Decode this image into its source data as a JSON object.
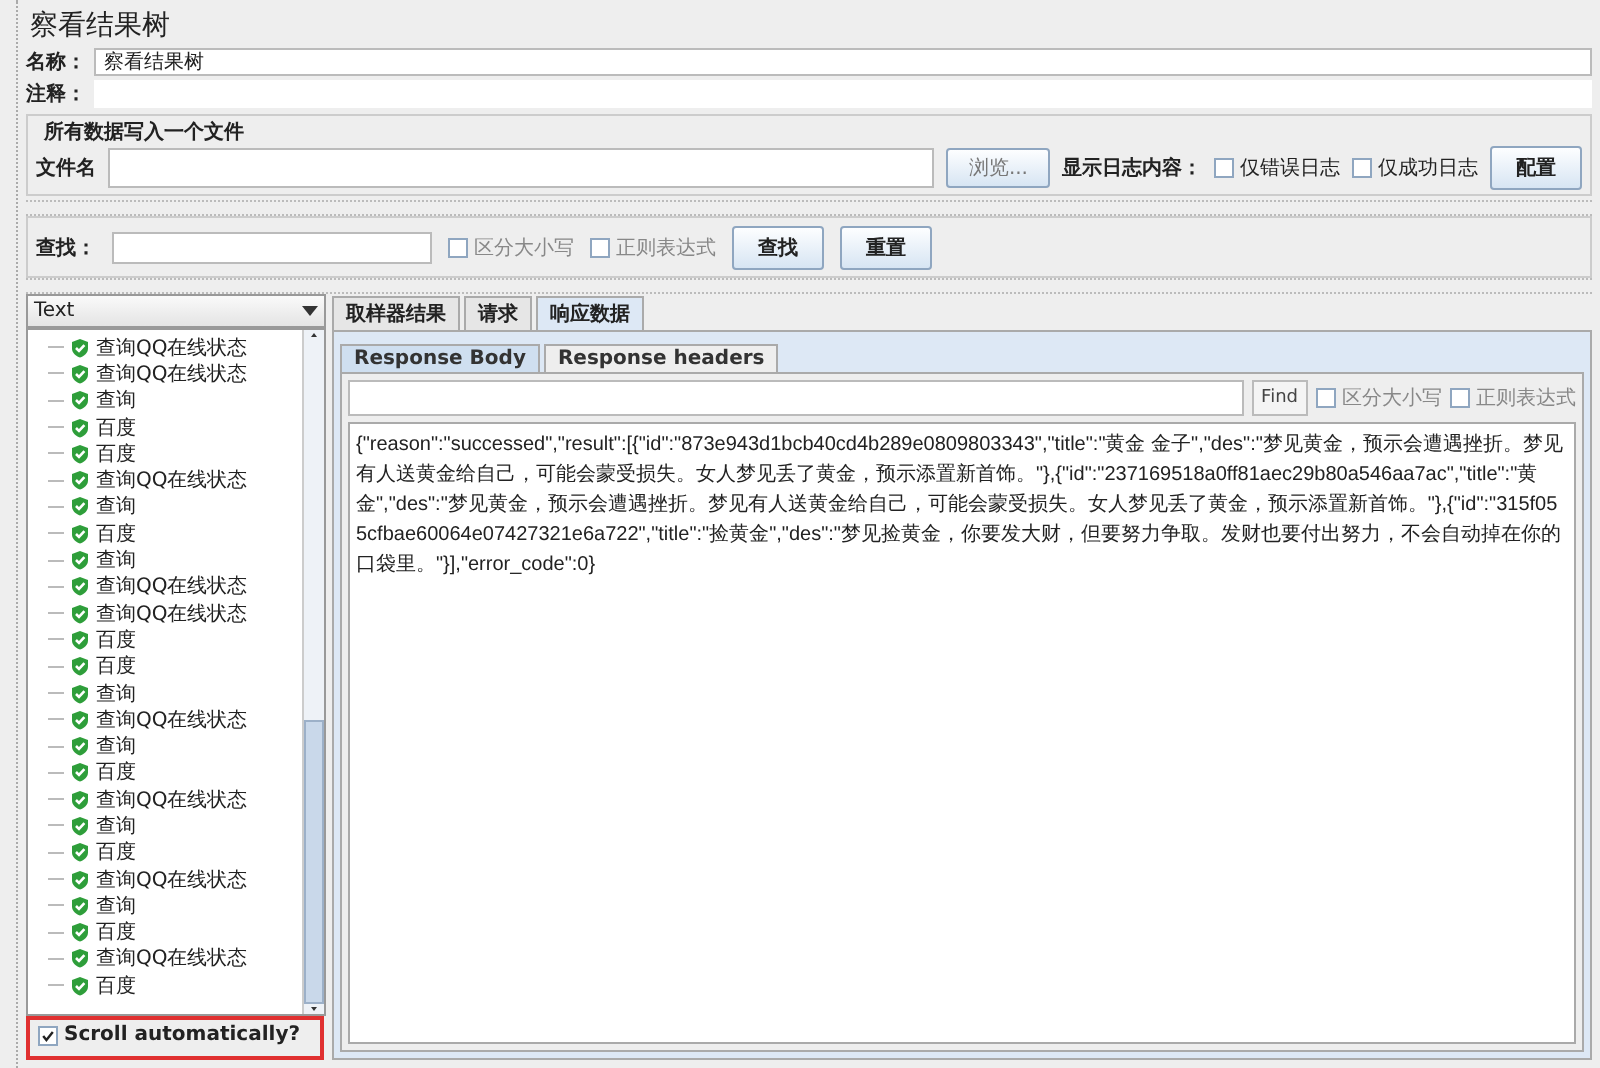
{
  "window": {
    "title": "察看结果树"
  },
  "name_field": {
    "label": "名称：",
    "value": "察看结果树"
  },
  "comment_field": {
    "label": "注释："
  },
  "file_group": {
    "title": "所有数据写入一个文件",
    "file_label": "文件名",
    "browse_button": "浏览...",
    "log_label": "显示日志内容：",
    "options": [
      {
        "label": "仅错误日志",
        "checked": false
      },
      {
        "label": "仅成功日志",
        "checked": false
      }
    ],
    "config_button": "配置"
  },
  "search": {
    "label": "查找：",
    "options": [
      {
        "label": "区分大小写",
        "checked": false
      },
      {
        "label": "正则表达式",
        "checked": false
      }
    ],
    "find_button": "查找",
    "reset_button": "重置"
  },
  "renderer": {
    "value": "Text"
  },
  "tree": {
    "items": [
      {
        "label": "查询QQ在线状态"
      },
      {
        "label": "查询QQ在线状态"
      },
      {
        "label": "查询"
      },
      {
        "label": "百度"
      },
      {
        "label": "百度"
      },
      {
        "label": "查询QQ在线状态"
      },
      {
        "label": "查询"
      },
      {
        "label": "百度"
      },
      {
        "label": "查询"
      },
      {
        "label": "查询QQ在线状态"
      },
      {
        "label": "查询QQ在线状态"
      },
      {
        "label": "百度"
      },
      {
        "label": "百度"
      },
      {
        "label": "查询"
      },
      {
        "label": "查询QQ在线状态"
      },
      {
        "label": "查询"
      },
      {
        "label": "百度"
      },
      {
        "label": "查询QQ在线状态"
      },
      {
        "label": "查询"
      },
      {
        "label": "百度"
      },
      {
        "label": "查询QQ在线状态"
      },
      {
        "label": "查询"
      },
      {
        "label": "百度"
      },
      {
        "label": "查询QQ在线状态"
      },
      {
        "label": "百度"
      }
    ]
  },
  "scroll_auto": {
    "label": "Scroll automatically?",
    "checked": true
  },
  "tabs": [
    {
      "label": "取样器结果",
      "selected": false
    },
    {
      "label": "请求",
      "selected": false
    },
    {
      "label": "响应数据",
      "selected": true
    }
  ],
  "subtabs": [
    {
      "label": "Response Body",
      "selected": true
    },
    {
      "label": "Response headers",
      "selected": false
    }
  ],
  "body_search": {
    "find_button": "Find",
    "options": [
      {
        "label": "区分大小写",
        "checked": false
      },
      {
        "label": "正则表达式",
        "checked": false
      }
    ]
  },
  "response_body": "{\"reason\":\"successed\",\"result\":[{\"id\":\"873e943d1bcb40cd4b289e0809803343\",\"title\":\"黄金 金子\",\"des\":\"梦见黄金，预示会遭遇挫折。梦见有人送黄金给自己，可能会蒙受损失。女人梦见丢了黄金，预示添置新首饰。\"},{\"id\":\"237169518a0ff81aec29b80a546aa7ac\",\"title\":\"黄金\",\"des\":\"梦见黄金，预示会遭遇挫折。梦见有人送黄金给自己，可能会蒙受损失。女人梦见丢了黄金，预示添置新首饰。\"},{\"id\":\"315f055cfbae60064e07427321e6a722\",\"title\":\"捡黄金\",\"des\":\"梦见捡黄金，你要发大财，但要努力争取。发财也要付出努力，不会自动掉在你的口袋里。\"}],\"error_code\":0}"
}
